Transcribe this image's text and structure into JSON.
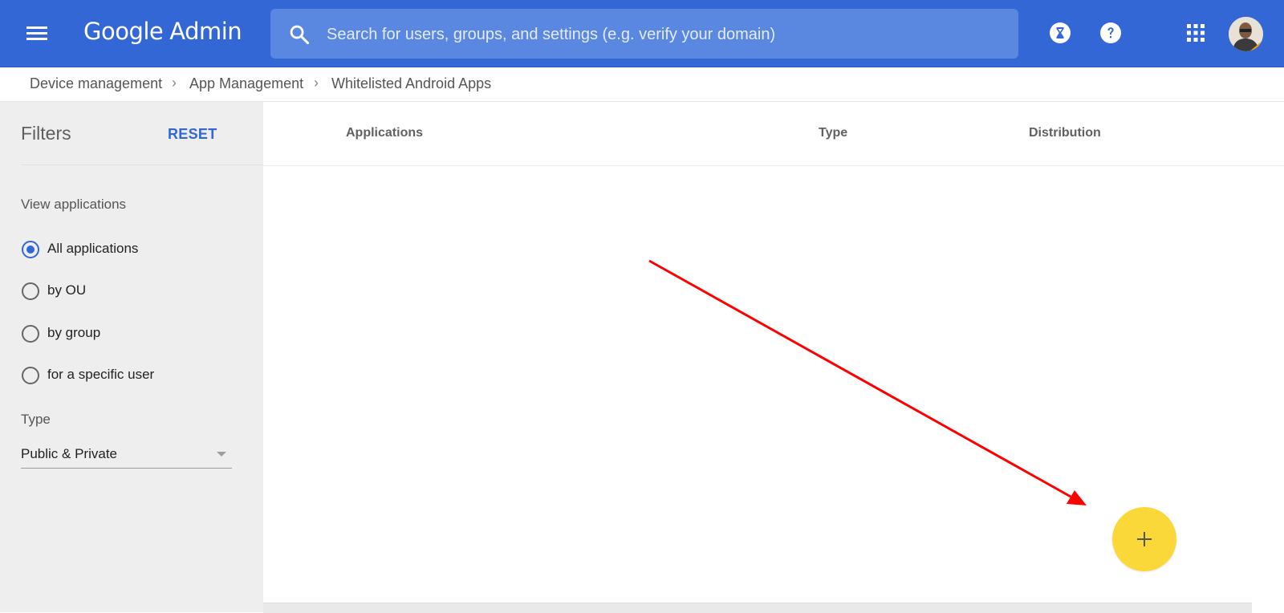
{
  "header": {
    "brand": "Google",
    "product": "Admin",
    "search_placeholder": "Search for users, groups, and settings (e.g. verify your domain)",
    "icons": [
      "menu-icon",
      "search-icon",
      "hourglass-icon",
      "help-icon",
      "apps-grid-icon",
      "avatar"
    ],
    "color": "#3367d6"
  },
  "breadcrumb": {
    "items": [
      "Device management",
      "App Management",
      "Whitelisted Android Apps"
    ],
    "separator": "›"
  },
  "sidebar": {
    "title": "Filters",
    "reset_label": "RESET",
    "view_label": "View applications",
    "options": [
      {
        "label": "All applications",
        "checked": true
      },
      {
        "label": "by OU",
        "checked": false
      },
      {
        "label": "by group",
        "checked": false
      },
      {
        "label": "for a specific user",
        "checked": false
      }
    ],
    "type_label": "Type",
    "type_value": "Public & Private"
  },
  "table": {
    "columns": [
      "Applications",
      "Type",
      "Distribution"
    ]
  },
  "fab": {
    "icon": "plus-icon",
    "color": "#fbd83a"
  },
  "annotation": {
    "type": "arrow",
    "color": "#ff0000"
  }
}
